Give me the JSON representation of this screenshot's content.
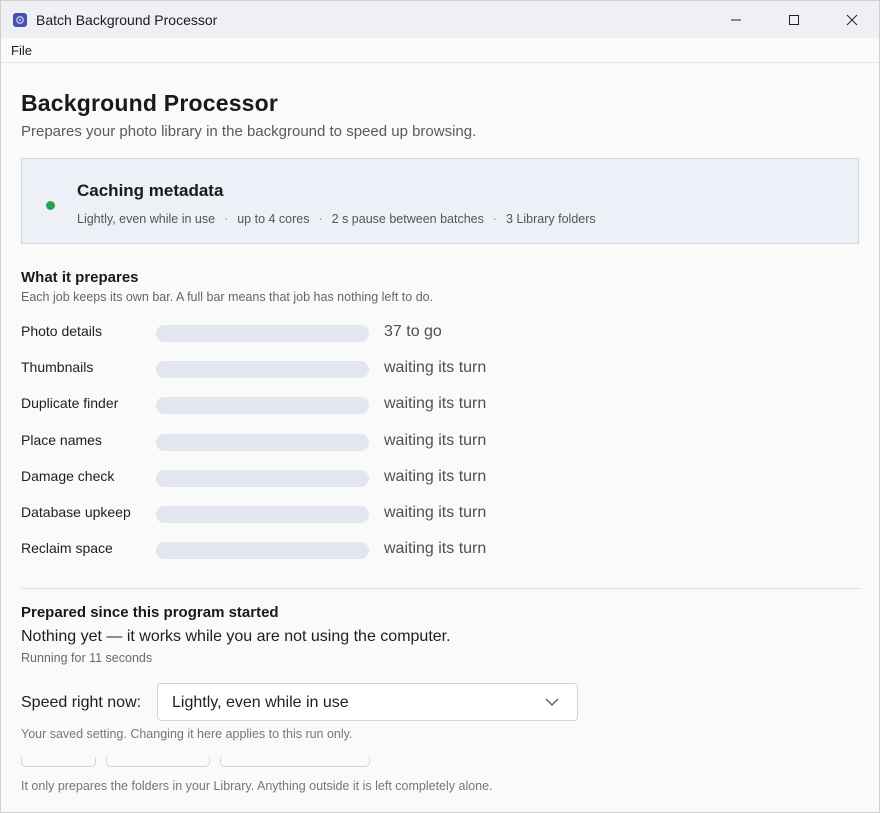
{
  "window": {
    "title": "Batch Background Processor",
    "icon": "app-icon",
    "controls": [
      "minimize-icon",
      "maximize-icon",
      "close-icon"
    ]
  },
  "menu": {
    "items": [
      "File"
    ]
  },
  "header": {
    "title": "Background Processor",
    "subtitle": "Prepares your photo library in the background to speed up browsing."
  },
  "status": {
    "title": "Caching metadata",
    "dot_color": "#2e9e4f",
    "details": [
      "Lightly, even while in use",
      "up to 4 cores",
      "2 s pause between batches",
      "3 Library folders"
    ],
    "separator": "·"
  },
  "jobs_section": {
    "title": "What it prepares",
    "note": "Each job keeps its own bar. A full bar means that job has nothing left to do.",
    "jobs": [
      {
        "label": "Photo details",
        "status": "37 to go",
        "progress": 0
      },
      {
        "label": "Thumbnails",
        "status": "waiting its turn",
        "progress": 0
      },
      {
        "label": "Duplicate finder",
        "status": "waiting its turn",
        "progress": 0
      },
      {
        "label": "Place names",
        "status": "waiting its turn",
        "progress": 0
      },
      {
        "label": "Damage check",
        "status": "waiting its turn",
        "progress": 0
      },
      {
        "label": "Database upkeep",
        "status": "waiting its turn",
        "progress": 0
      },
      {
        "label": "Reclaim space",
        "status": "waiting its turn",
        "progress": 0
      }
    ]
  },
  "prepared_section": {
    "title": "Prepared since this program started",
    "summary": "Nothing yet — it works while you are not using the computer.",
    "running": "Running for 11 seconds"
  },
  "speed": {
    "label": "Speed right now:",
    "selected": "Lightly, even while in use",
    "note": "Your saved setting. Changing it here applies to this run only."
  },
  "footer": {
    "note": "It only prepares the folders in your Library. Anything outside it is left completely alone."
  }
}
